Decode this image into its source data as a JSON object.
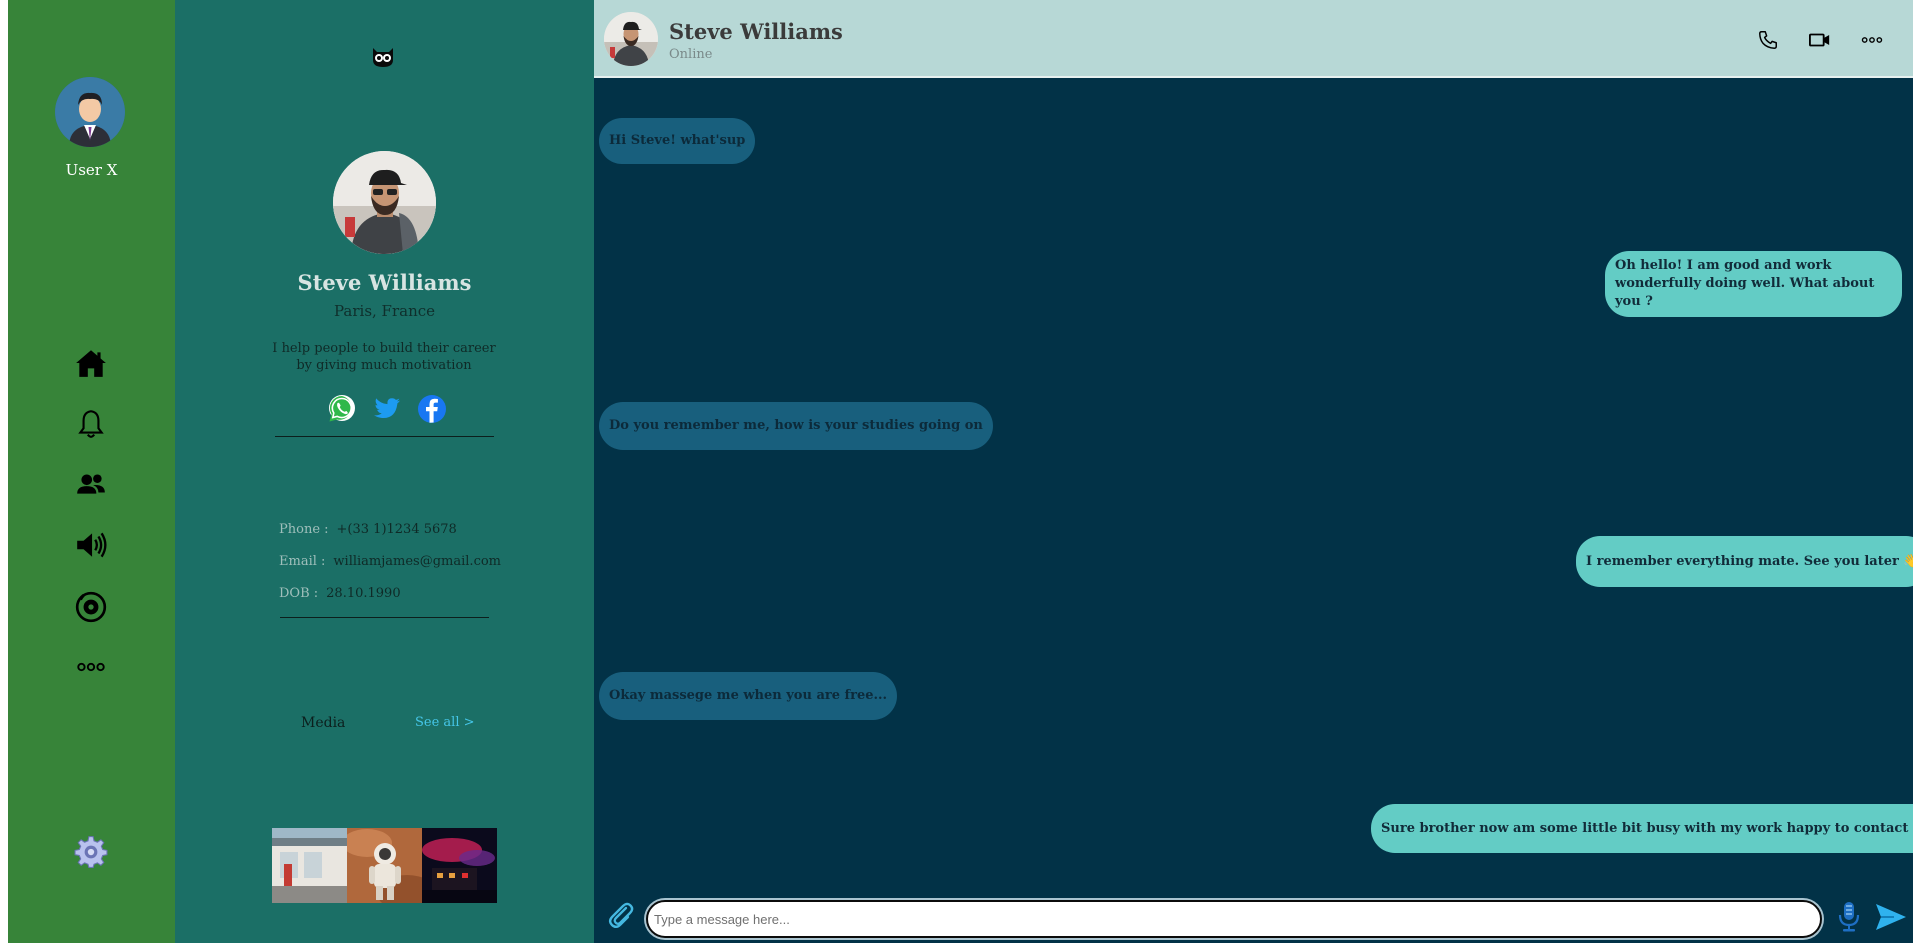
{
  "nav": {
    "user_name": "User X",
    "items": [
      {
        "name": "home",
        "icon": "home-icon"
      },
      {
        "name": "notifications",
        "icon": "bell-icon"
      },
      {
        "name": "contacts",
        "icon": "users-icon"
      },
      {
        "name": "audio",
        "icon": "speaker-icon"
      },
      {
        "name": "stories",
        "icon": "disc-icon"
      },
      {
        "name": "more",
        "icon": "more-horizontal-icon"
      }
    ],
    "settings_icon": "gear-icon",
    "colors": {
      "background": "#378439"
    }
  },
  "profile": {
    "logo_icon": "owl-icon",
    "name": "Steve Williams",
    "location": "Paris, France",
    "bio": "I help people to build their career by giving much motivation",
    "socials": [
      "whatsapp-icon",
      "twitter-icon",
      "facebook-icon"
    ],
    "phone_label": "Phone :",
    "phone": "+(33 1)1234 5678",
    "email_label": "Email :",
    "email": "williamjames@gmail.com",
    "dob_label": "DOB :",
    "dob": "28.10.1990",
    "media_label": "Media",
    "see_all": "See all >",
    "media_thumbs": [
      "media-thumb-station",
      "media-thumb-astronaut",
      "media-thumb-night-building"
    ],
    "colors": {
      "background": "#1b6f66"
    }
  },
  "chat": {
    "header": {
      "name": "Steve Williams",
      "status": "Online",
      "actions": [
        "phone-icon",
        "video-icon",
        "more-horizontal-icon"
      ]
    },
    "messages": [
      {
        "direction": "in",
        "text": "Hi Steve! what'sup"
      },
      {
        "direction": "out",
        "text": "Oh hello! I am good and work wonderfully doing well. What about you ?",
        "lines": [
          "Oh hello! I am good and work",
          "wonderfully doing well. What about you ?"
        ]
      },
      {
        "direction": "in",
        "text": "Do you remember me, how is your studies going on"
      },
      {
        "direction": "out",
        "text": "I remember everything mate. See you later 👋"
      },
      {
        "direction": "in",
        "text": "Okay massege me when you are free..."
      },
      {
        "direction": "out",
        "text": "Sure brother now am some little bit busy with my work happy to contact me."
      }
    ],
    "composer": {
      "placeholder": "Type a message here...",
      "value": ""
    },
    "colors": {
      "background": "#023247",
      "header": "#b7d8d6",
      "incoming": "#185f7d",
      "outgoing": "#63ccc5"
    }
  }
}
